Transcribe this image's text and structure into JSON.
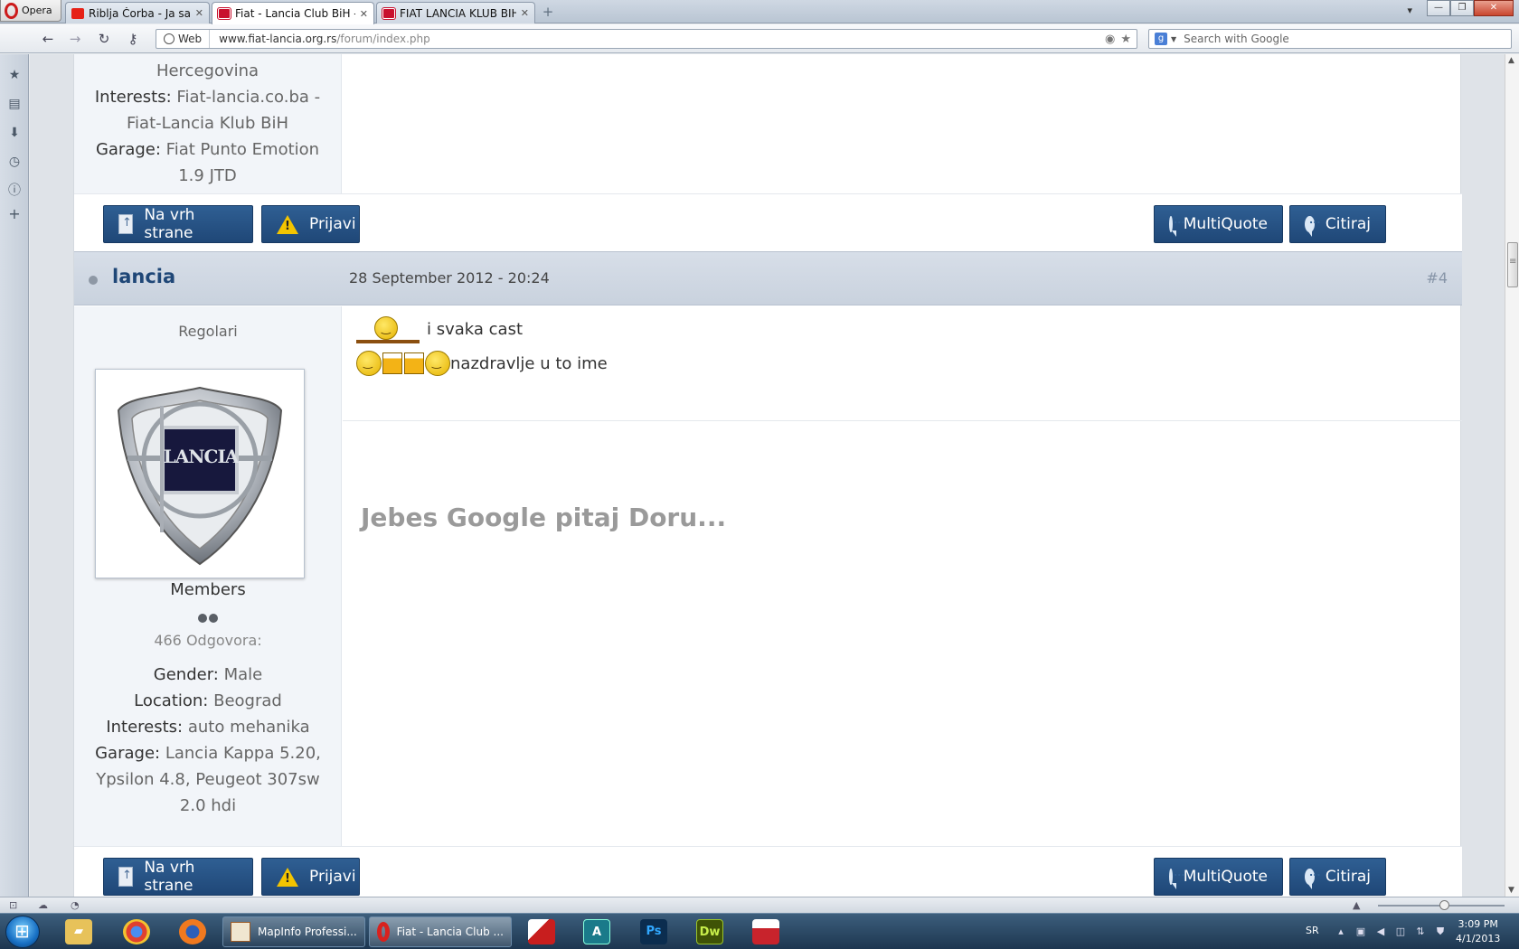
{
  "browser": {
    "menu_label": "Opera",
    "tabs": [
      {
        "title": "Riblja Čorba - Ja sam s...",
        "favicon": "youtube-favicon",
        "active": false
      },
      {
        "title": "Fiat - Lancia Club BiH -...",
        "favicon": "fiat-lancia-favicon",
        "active": true
      },
      {
        "title": "FIAT LANCIA KLUB BIH",
        "favicon": "fiat-lancia-favicon",
        "active": false
      }
    ],
    "web_badge": "Web",
    "url_host": "www.fiat-lancia.org.rs",
    "url_path": "/forum/index.php",
    "search_placeholder": "Search with Google"
  },
  "prev_post": {
    "author_lines": [
      {
        "label": "",
        "value": "Hercegovina"
      },
      {
        "label": "Interests:",
        "value": "Fiat-lancia.co.ba -"
      },
      {
        "label": "",
        "value": "Fiat-Lancia Klub BiH"
      },
      {
        "label": "Garage:",
        "value": "Fiat Punto Emotion"
      },
      {
        "label": "",
        "value": "1.9 JTD"
      }
    ]
  },
  "post_actions": {
    "top_label": "Na vrh strane",
    "report_label": "Prijavi",
    "multiquote_label": "MultiQuote",
    "quote_label": "Citiraj"
  },
  "post": {
    "username": "lancia",
    "date": "28 September 2012 - 20:24",
    "number": "#4",
    "body_line1": "i svaka cast",
    "body_line2": "nazdravlje  u to ime",
    "signature": "Jebes Google pitaj Doru...",
    "author": {
      "rank_title": "Regolari",
      "avatar_text": "LANCIA",
      "group": "Members",
      "pips": 2,
      "replies": "466 Odgovora:",
      "gender_label": "Gender:",
      "gender": "Male",
      "location_label": "Location:",
      "location": "Beograd",
      "interests_label": "Interests:",
      "interests": "auto mehanika",
      "garage_label": "Garage:",
      "garage_line1": "Lancia Kappa 5.20,",
      "garage_line2": "Ypsilon 4.8, Peugeot 307sw",
      "garage_line3": "2.0 hdi"
    }
  },
  "taskbar": {
    "items": [
      {
        "label": "MapInfo Professi...",
        "active": false
      },
      {
        "label": "Fiat - Lancia Club ...",
        "active": true
      }
    ],
    "app_icons": [
      "Ps",
      "Dw"
    ],
    "language": "SR",
    "time": "3:09 PM",
    "date": "4/1/2013"
  },
  "colors": {
    "accent": "#1f4777",
    "header_band": "#cfd7e2",
    "signature": "#9a9a9a"
  }
}
